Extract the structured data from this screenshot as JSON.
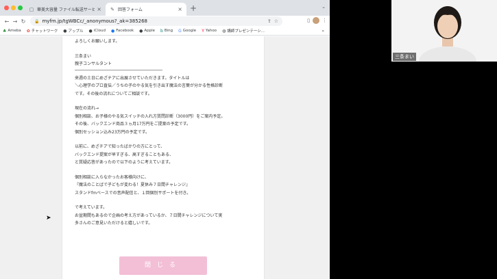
{
  "browser": {
    "tabs": [
      {
        "title": "華美大容量 ファイル転送サービス",
        "icon": "file-icon"
      },
      {
        "title": "回答フォーム",
        "icon": "pencil-icon"
      }
    ],
    "new_tab_label": "+",
    "url": "myfm.jp/tgWBCc/_anonymous?_ak=385268",
    "bookmarks": [
      {
        "label": "Ameba",
        "icon": "ameba-icon"
      },
      {
        "label": "チャットワーク",
        "icon": "chatwork-icon"
      },
      {
        "label": "アップル",
        "icon": "apple-icon"
      },
      {
        "label": "iCloud",
        "icon": "apple-icon"
      },
      {
        "label": "Facebook",
        "icon": "facebook-icon"
      },
      {
        "label": "Apple",
        "icon": "apple-icon"
      },
      {
        "label": "Bing",
        "icon": "bing-icon"
      },
      {
        "label": "Google",
        "icon": "google-icon"
      },
      {
        "label": "Yahoo",
        "icon": "yahoo-icon"
      },
      {
        "label": "講師プレゼンテーシ...",
        "icon": "globe-icon"
      }
    ],
    "bookmarks_more": "»"
  },
  "form": {
    "lines": [
      "よろしくお願いします。",
      "",
      "三条まい",
      "親子コンサルタント"
    ],
    "body": [
      "来週の土日にめざチアに出展させていただきます。タイトルは",
      "＼心理学のプロ直伝／うちの子のやる気を引き出す魔法の言葉が分かる性格診断",
      "です。その後の流れについてご相談です。",
      "",
      "現在の流れ→",
      "個別相談、お子様のやる気スイッチの入れ方質問診断（3000円）をご案内予定。",
      "その後、バックエンド商品３ヵ月17万円をご提案の予定です。",
      "個別セッション込み23万円の予定です。",
      "",
      "以前に、めざチアで知ったばかりの方にとって、",
      "バックエンド提案が早すぎる、高すぎることもある、",
      "と質疑応答があったので以下のように考えています。",
      "",
      "個別相談に入らなかったお客様向けに、",
      "『魔法のことばで子どもが変わる！夏休み７日間チャレンジ』",
      "スタンドfmベースでの音声配信と、１回個別サポートを付き。",
      "",
      "で考えています。",
      "お盆期間もあるので企画の考え方があっているか、７日間チャレンジについて実",
      "多さんのご意見いただけると嬉しいです。"
    ],
    "close_label": "閉じる",
    "accent_color": "#f3bfd6"
  },
  "video": {
    "participant_name": "三条まい"
  }
}
